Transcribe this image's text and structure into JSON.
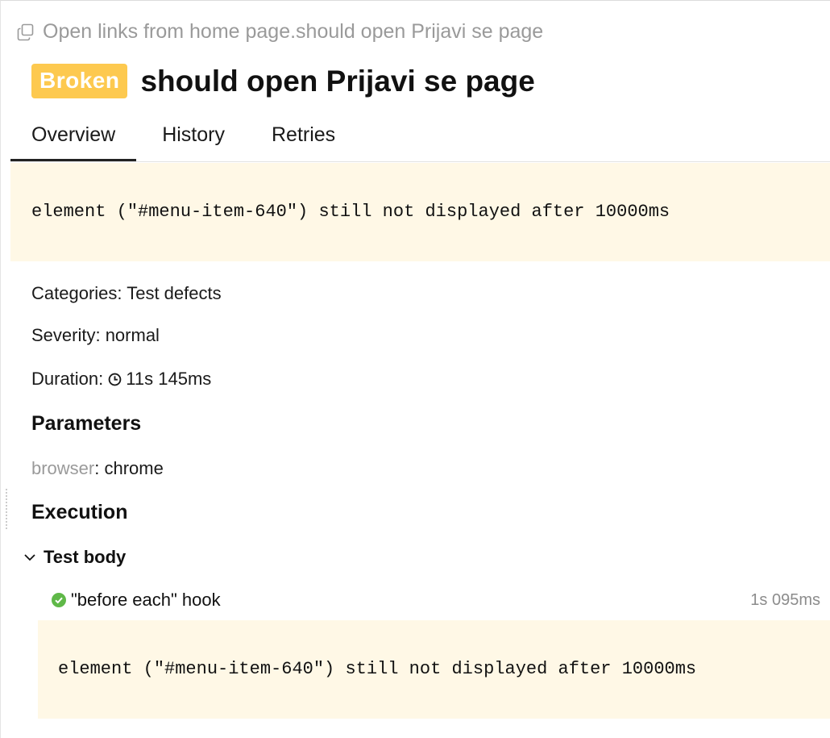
{
  "breadcrumb": {
    "icon": "copy-icon",
    "text": "Open links from home page.should open Prijavi se page"
  },
  "test": {
    "status": "Broken",
    "status_color": "#fdc94f",
    "title": "should open Prijavi se page"
  },
  "tabs": [
    {
      "label": "Overview",
      "active": true
    },
    {
      "label": "History",
      "active": false
    },
    {
      "label": "Retries",
      "active": false
    }
  ],
  "error_message": "element (\"#menu-item-640\") still not displayed after 10000ms",
  "overview": {
    "categories": "Categories: Test defects",
    "severity": "Severity: normal",
    "duration_label": "Duration:",
    "duration_icon": "clock-icon",
    "duration_value": "11s 145ms"
  },
  "parameters": {
    "heading": "Parameters",
    "items": [
      {
        "name": "browser",
        "value": "chrome"
      }
    ]
  },
  "execution": {
    "heading": "Execution",
    "group": {
      "label": "Test body",
      "expanded": true,
      "steps": [
        {
          "status": "passed",
          "status_icon": "check-circle-icon",
          "status_color": "#5fb848",
          "name": "\"before each\" hook",
          "duration": "1s 095ms",
          "message": "element (\"#menu-item-640\") still not displayed after 10000ms"
        }
      ]
    }
  }
}
